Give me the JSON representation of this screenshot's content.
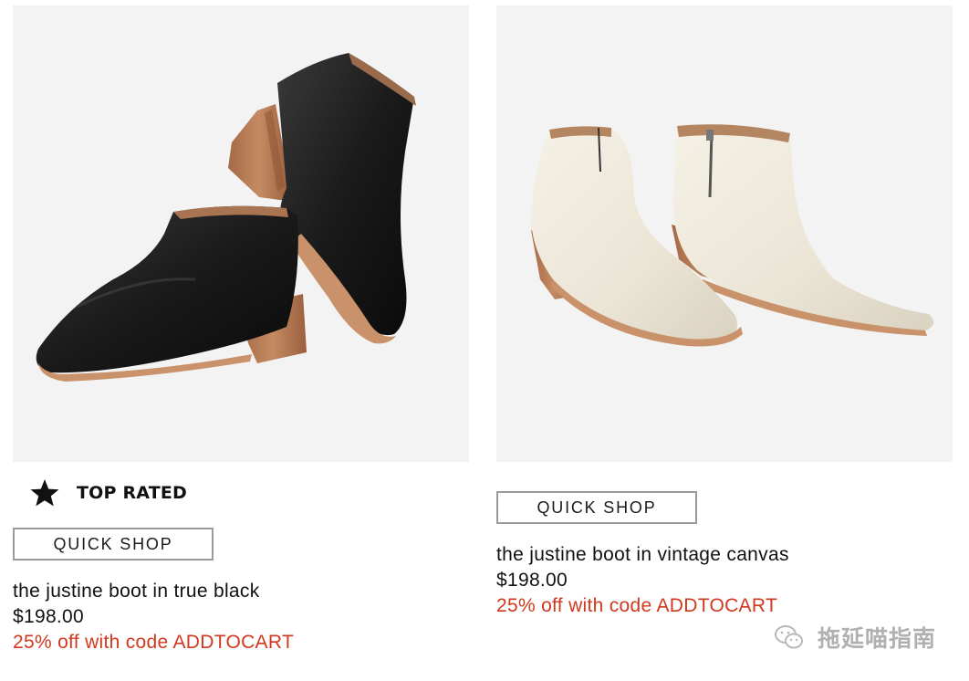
{
  "products": [
    {
      "badge": "TOP RATED",
      "quick_shop_label": "QUICK SHOP",
      "name": "the justine boot in true black",
      "price": "$198.00",
      "promo": "25% off with code ADDTOCART",
      "image_icon": "black-ankle-boot-image"
    },
    {
      "quick_shop_label": "QUICK SHOP",
      "name": "the justine boot in vintage canvas",
      "price": "$198.00",
      "promo": "25% off with code ADDTOCART",
      "image_icon": "cream-ankle-boot-image"
    }
  ],
  "watermark": {
    "text": "拖延喵指南",
    "icon": "wechat-icon"
  },
  "colors": {
    "promo": "#d2381e",
    "image_bg": "#f3f3f3",
    "button_border": "#9b9b9b",
    "leather_black": "#1c1c1c",
    "leather_cream": "#ece7da",
    "heel_wood": "#b97a55"
  }
}
